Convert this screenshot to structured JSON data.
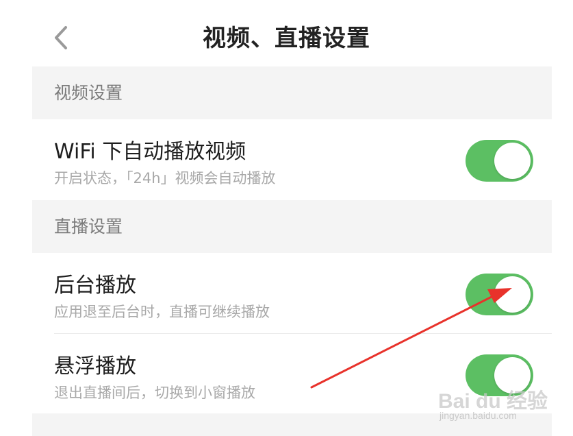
{
  "header": {
    "title": "视频、直播设置",
    "back_icon": "chevron-left-icon"
  },
  "sections": [
    {
      "label": "视频设置"
    },
    {
      "label": "直播设置"
    }
  ],
  "settings": [
    {
      "title": "WiFi 下自动播放视频",
      "desc": "开启状态，「24h」视频会自动播放",
      "enabled": true
    },
    {
      "title": "后台播放",
      "desc": "应用退至后台时，直播可继续播放",
      "enabled": true
    },
    {
      "title": "悬浮播放",
      "desc": "退出直播间后，切换到小窗播放",
      "enabled": true
    }
  ],
  "colors": {
    "toggle_on": "#5cbf63",
    "section_bg": "#f4f4f4",
    "arrow": "#e8322b"
  },
  "watermark": {
    "brand": "Bai du 经验",
    "url": "jingyan.baidu.com"
  }
}
